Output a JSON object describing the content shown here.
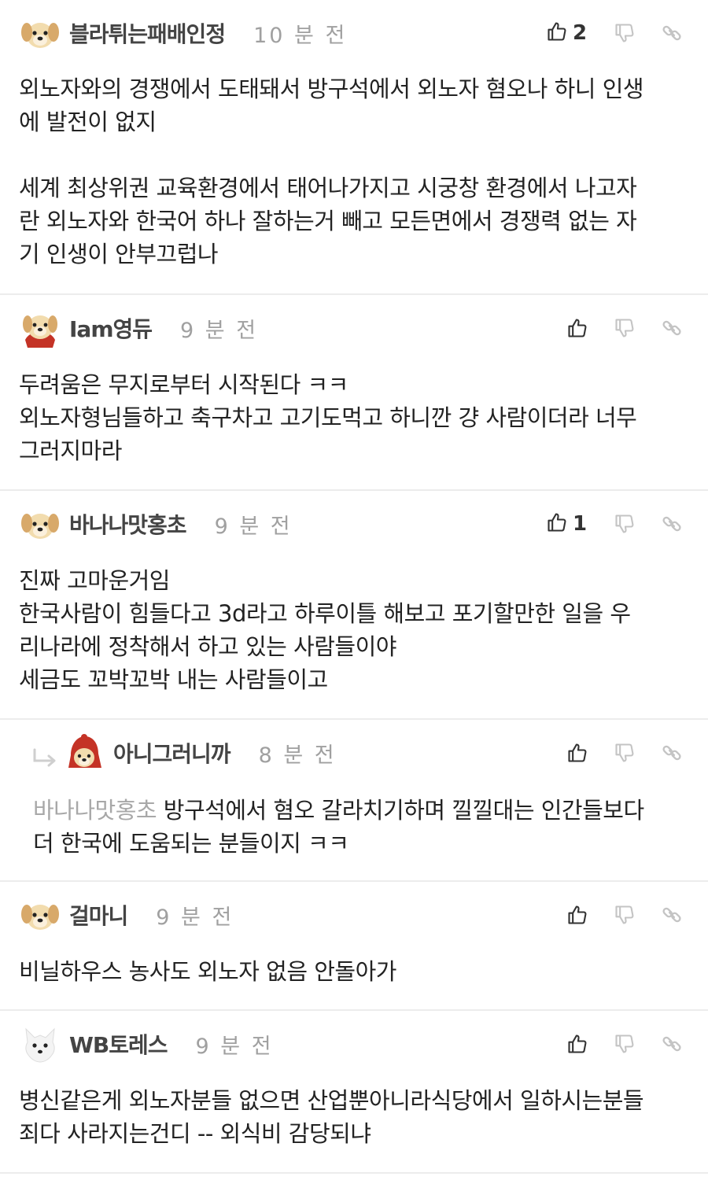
{
  "comments": [
    {
      "nick": "블라튀는패배인정",
      "time": "10 분 전",
      "likes": "2",
      "lines": [
        "외노자와의 경쟁에서 도태돼서 방구석에서 외노자 혐오나 하니 인생",
        "에 발전이 없지",
        "",
        "세계 최상위권 교육환경에서 태어나가지고 시궁창 환경에서 나고자",
        "란 외노자와 한국어 하나 잘하는거 빼고 모든면에서 경쟁력 없는 자",
        "기 인생이 안부끄럽나"
      ]
    },
    {
      "nick": "Iam영듀",
      "time": "9 분 전",
      "likes": "",
      "lines": [
        "두려움은 무지로부터 시작된다 ㅋㅋ",
        "외노자형님들하고 축구차고 고기도먹고 하니깐 걍 사람이더라 너무",
        "그러지마라"
      ]
    },
    {
      "nick": "바나나맛홍초",
      "time": "9 분 전",
      "likes": "1",
      "lines": [
        "진짜 고마운거임",
        "한국사람이 힘들다고 3d라고 하루이틀 해보고 포기할만한 일을 우",
        "리나라에 정착해서 하고 있는 사람들이야",
        "세금도 꼬박꼬박 내는 사람들이고"
      ]
    },
    {
      "nick": "아니그러니까",
      "time": "8 분 전",
      "likes": "",
      "mention": "바나나맛홍초",
      "lines": [
        " 방구석에서 혐오 갈라치기하며 낄낄대는 인간들보다",
        "더 한국에 도움되는 분들이지 ㅋㅋ"
      ]
    },
    {
      "nick": "걸마니",
      "time": "9 분 전",
      "likes": "",
      "lines": [
        "비닐하우스 농사도 외노자 없음 안돌아가"
      ]
    },
    {
      "nick": "WB토레스",
      "time": "9 분 전",
      "likes": "",
      "lines": [
        "병신같은게 외노자분들 없으면 산업뿐아니라식당에서 일하시는분들",
        "죄다 사라지는건디 -- 외식비 감당되냐"
      ]
    }
  ],
  "icons": {
    "like": "thumbs-up-icon",
    "dislike": "thumbs-down-icon",
    "share": "link-icon",
    "reply": "reply-arrow-icon"
  },
  "colors": {
    "text": "#222222",
    "nickname": "#444444",
    "muted": "#a0a0a0",
    "icon_dark": "#333333",
    "icon_light": "#c4c4c4",
    "divider": "#ececec"
  }
}
